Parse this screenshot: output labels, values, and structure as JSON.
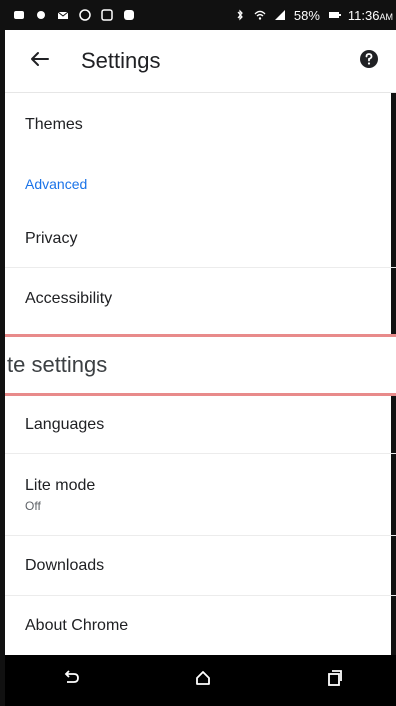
{
  "status_bar": {
    "battery": "58%",
    "time": "11:36",
    "ampm": "AM"
  },
  "app_bar": {
    "title": "Settings"
  },
  "list": {
    "themes": "Themes",
    "advanced_header": "Advanced",
    "privacy": "Privacy",
    "accessibility": "Accessibility",
    "site_settings_partial": "te settings",
    "languages": "Languages",
    "lite_mode": "Lite mode",
    "lite_mode_state": "Off",
    "downloads": "Downloads",
    "about_chrome": "About Chrome"
  },
  "colors": {
    "accent": "#1a73e8",
    "highlight_border": "#e88a8a"
  },
  "icons": {
    "back": "arrow-back-icon",
    "help": "help-icon",
    "nav_back": "back-icon",
    "nav_home": "home-icon",
    "nav_recents": "recents-icon"
  }
}
